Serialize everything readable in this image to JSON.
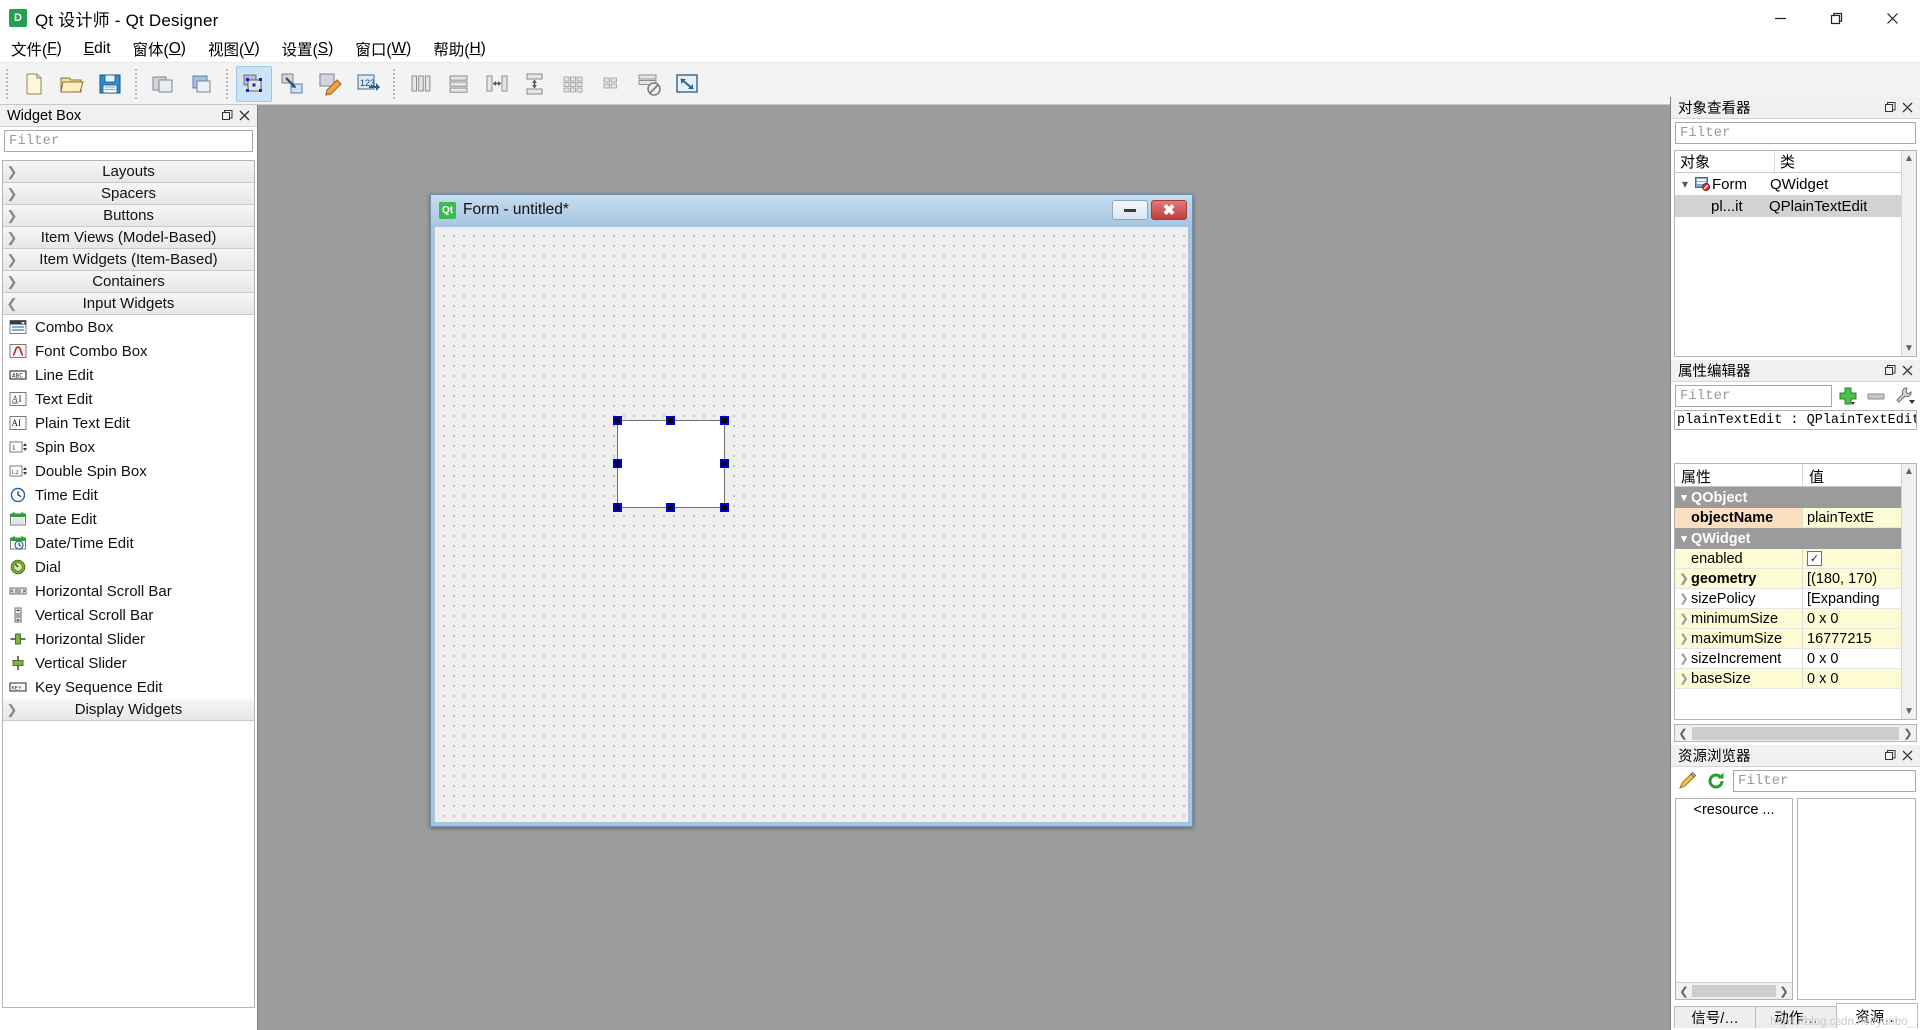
{
  "window": {
    "title": "Qt 设计师 - Qt Designer",
    "app_badge": "D",
    "minimize_label": "最小化",
    "maximize_label": "最大化",
    "close_label": "关闭"
  },
  "menubar": {
    "items": [
      {
        "label": "文件(F)",
        "pre": "文件(",
        "key": "F",
        "post": ")"
      },
      {
        "label": "Edit",
        "pre": "",
        "key": "E",
        "post": "dit"
      },
      {
        "label": "窗体(O)",
        "pre": "窗体(",
        "key": "O",
        "post": ")"
      },
      {
        "label": "视图(V)",
        "pre": "视图(",
        "key": "V",
        "post": ")"
      },
      {
        "label": "设置(S)",
        "pre": "设置(",
        "key": "S",
        "post": ")"
      },
      {
        "label": "窗口(W)",
        "pre": "窗口(",
        "key": "W",
        "post": ")"
      },
      {
        "label": "帮助(H)",
        "pre": "帮助(",
        "key": "H",
        "post": ")"
      }
    ]
  },
  "toolbar": {
    "groups": [
      {
        "buttons": [
          {
            "name": "new-form-button",
            "icon": "new-document-icon",
            "active": false
          },
          {
            "name": "open-form-button",
            "icon": "open-folder-icon",
            "active": false
          },
          {
            "name": "save-form-button",
            "icon": "save-disk-icon",
            "active": false
          }
        ]
      },
      {
        "buttons": [
          {
            "name": "undo-button",
            "icon": "undo-icon",
            "active": false
          },
          {
            "name": "redo-button",
            "icon": "redo-icon",
            "active": false
          }
        ]
      },
      {
        "buttons": [
          {
            "name": "edit-widgets-button",
            "icon": "edit-widgets-icon",
            "active": true
          },
          {
            "name": "edit-signals-slots-button",
            "icon": "signals-slots-icon",
            "active": false
          },
          {
            "name": "edit-buddies-button",
            "icon": "edit-buddies-icon",
            "active": false
          },
          {
            "name": "edit-tab-order-button",
            "icon": "tab-order-icon",
            "active": false
          }
        ]
      },
      {
        "buttons": [
          {
            "name": "layout-horizontally-button",
            "icon": "layout-horizontal-icon",
            "active": false
          },
          {
            "name": "layout-vertically-button",
            "icon": "layout-vertical-icon",
            "active": false
          },
          {
            "name": "layout-splitter-horizontal-button",
            "icon": "splitter-horizontal-icon",
            "active": false
          },
          {
            "name": "layout-splitter-vertical-button",
            "icon": "splitter-vertical-icon",
            "active": false
          },
          {
            "name": "layout-grid-button",
            "icon": "layout-grid-icon",
            "active": false
          },
          {
            "name": "layout-form-button",
            "icon": "layout-form-icon",
            "active": false
          },
          {
            "name": "break-layout-button",
            "icon": "break-layout-icon",
            "active": false
          },
          {
            "name": "adjust-size-button",
            "icon": "adjust-size-icon",
            "active": false
          }
        ]
      }
    ]
  },
  "widget_box": {
    "title": "Widget Box",
    "filter_placeholder": "Filter",
    "categories": [
      {
        "label": "Layouts",
        "expanded": false,
        "items": []
      },
      {
        "label": "Spacers",
        "expanded": false,
        "items": []
      },
      {
        "label": "Buttons",
        "expanded": false,
        "items": []
      },
      {
        "label": "Item Views (Model-Based)",
        "expanded": false,
        "items": []
      },
      {
        "label": "Item Widgets (Item-Based)",
        "expanded": false,
        "items": []
      },
      {
        "label": "Containers",
        "expanded": false,
        "items": []
      },
      {
        "label": "Input Widgets",
        "expanded": true,
        "items": [
          {
            "label": "Combo Box",
            "icon": "combobox-icon"
          },
          {
            "label": "Font Combo Box",
            "icon": "fontcombobox-icon"
          },
          {
            "label": "Line Edit",
            "icon": "lineedit-icon"
          },
          {
            "label": "Text Edit",
            "icon": "textedit-icon"
          },
          {
            "label": "Plain Text Edit",
            "icon": "plaintextedit-icon"
          },
          {
            "label": "Spin Box",
            "icon": "spinbox-icon"
          },
          {
            "label": "Double Spin Box",
            "icon": "doublespinbox-icon"
          },
          {
            "label": "Time Edit",
            "icon": "timeedit-icon"
          },
          {
            "label": "Date Edit",
            "icon": "dateedit-icon"
          },
          {
            "label": "Date/Time Edit",
            "icon": "datetimeedit-icon"
          },
          {
            "label": "Dial",
            "icon": "dial-icon"
          },
          {
            "label": "Horizontal Scroll Bar",
            "icon": "hscrollbar-icon"
          },
          {
            "label": "Vertical Scroll Bar",
            "icon": "vscrollbar-icon"
          },
          {
            "label": "Horizontal Slider",
            "icon": "hslider-icon"
          },
          {
            "label": "Vertical Slider",
            "icon": "vslider-icon"
          },
          {
            "label": "Key Sequence Edit",
            "icon": "keysequenceedit-icon"
          }
        ]
      },
      {
        "label": "Display Widgets",
        "expanded": false,
        "items": []
      }
    ]
  },
  "form_window": {
    "title": "Form - untitled*",
    "badge": "Qt",
    "selected_widget": "plainTextEdit"
  },
  "object_inspector": {
    "title": "对象查看器",
    "filter_placeholder": "Filter",
    "columns": [
      "对象",
      "类"
    ],
    "rows": [
      {
        "name": "Form",
        "class": "QWidget",
        "level": 0,
        "selected": false,
        "expanded": true
      },
      {
        "name": "pl...it",
        "class": "QPlainTextEdit",
        "level": 1,
        "selected": true,
        "expanded": false
      }
    ]
  },
  "property_editor": {
    "title": "属性编辑器",
    "filter_placeholder": "Filter",
    "object_line": "plainTextEdit : QPlainTextEdit",
    "columns": [
      "属性",
      "值"
    ],
    "rows": [
      {
        "key": "QObject",
        "value": "",
        "type": "group"
      },
      {
        "key": "objectName",
        "value": "plainTextE",
        "type": "orange",
        "bold": true,
        "indent": true
      },
      {
        "key": "QWidget",
        "value": "",
        "type": "group"
      },
      {
        "key": "enabled",
        "value": "",
        "type": "yellow",
        "widget": "checkbox",
        "checked": true,
        "indent": true
      },
      {
        "key": "geometry",
        "value": "[(180, 170)",
        "type": "yellow",
        "bold": true,
        "expandable": true
      },
      {
        "key": "sizePolicy",
        "value": "[Expanding",
        "type": "plain",
        "expandable": true
      },
      {
        "key": "minimumSize",
        "value": "0 x 0",
        "type": "yellow",
        "expandable": true
      },
      {
        "key": "maximumSize",
        "value": "16777215",
        "type": "yellow",
        "expandable": true
      },
      {
        "key": "sizeIncrement",
        "value": "0 x 0",
        "type": "plain",
        "expandable": true
      },
      {
        "key": "baseSize",
        "value": "0 x 0",
        "type": "yellow",
        "expandable": true
      }
    ],
    "add_label": "添加动态属性",
    "remove_label": "移除动态属性",
    "config_label": "配置属性编辑器"
  },
  "resource_browser": {
    "title": "资源浏览器",
    "filter_placeholder": "Filter",
    "edit_label": "编辑资源",
    "reload_label": "重新载入",
    "root_node": "<resource ...",
    "tabs": [
      {
        "label": "信号/…",
        "active": false
      },
      {
        "label": "动作…",
        "active": false
      },
      {
        "label": "资源…",
        "active": true
      }
    ]
  },
  "watermark": "https://blog.csdn.net/yunbo_"
}
